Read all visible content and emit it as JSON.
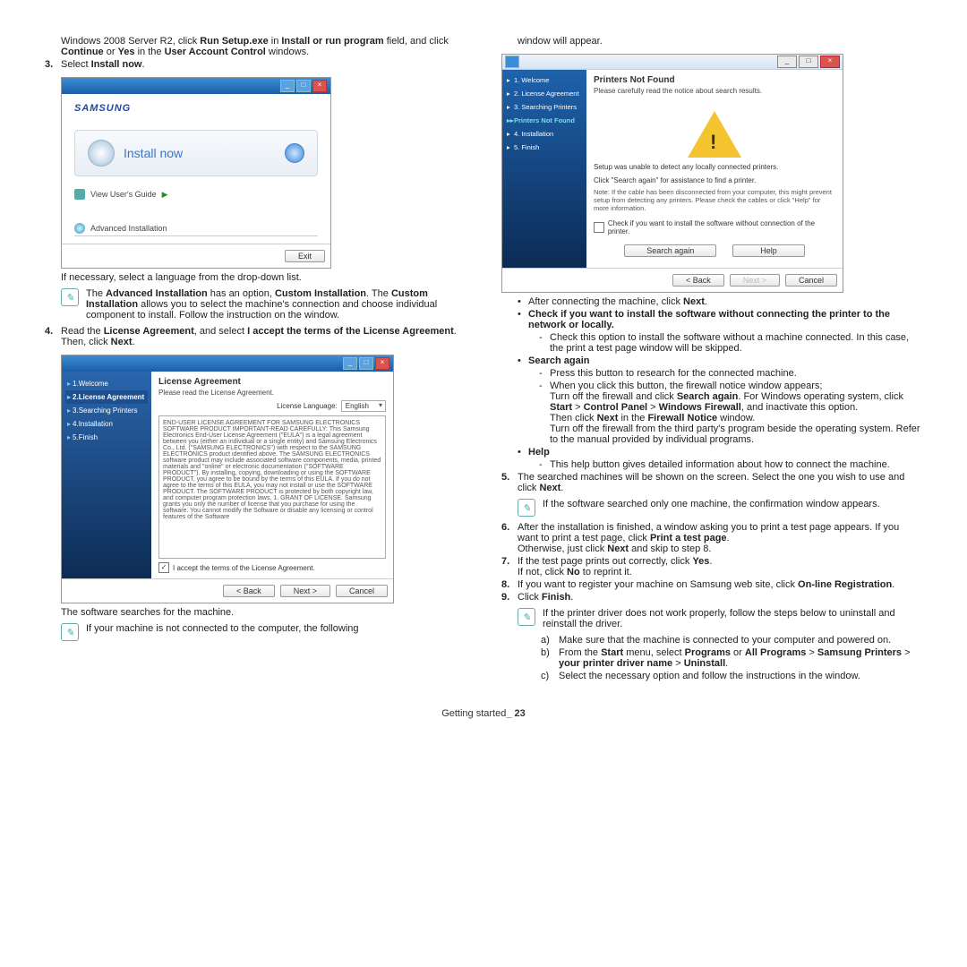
{
  "footer": {
    "text": "Getting started",
    "page": "23"
  },
  "left": {
    "intro_prefix": "Windows 2008 Server R2, click ",
    "intro_b1": "Run Setup.exe",
    "intro_mid1": " in ",
    "intro_b2": "Install or run program",
    "intro_mid2": " field, and click ",
    "intro_b3": "Continue",
    "intro_mid3": " or ",
    "intro_b4": "Yes",
    "intro_mid4": " in the ",
    "intro_b5": "User Account Control",
    "intro_end": " windows.",
    "step3_num": "3.",
    "step3_text_a": "Select ",
    "step3_text_b": "Install now",
    "step3_text_c": ".",
    "shot1": {
      "logo": "SAMSUNG",
      "install_now": "Install now",
      "view_guide": "View User's Guide",
      "advanced": "Advanced Installation",
      "exit": "Exit"
    },
    "after_shot1": "If necessary, select a language from the drop-down list.",
    "note1_a": "The ",
    "note1_b": "Advanced Installation",
    "note1_c": " has an option, ",
    "note1_d": "Custom Installation",
    "note1_e": ". The ",
    "note1_f": "Custom Installation",
    "note1_g": " allows you to select the machine's connection and choose individual component to install. Follow the instruction on the window.",
    "step4_num": "4.",
    "step4_a": "Read the ",
    "step4_b": "License Agreement",
    "step4_c": ", and select ",
    "step4_d": "I accept the terms of the License Agreement",
    "step4_e": ". Then, click ",
    "step4_f": "Next",
    "step4_g": ".",
    "shot2": {
      "sb1": "1.Welcome",
      "sb2": "2.License Agreement",
      "sb3": "3.Searching Printers",
      "sb4": "4.Installation",
      "sb5": "5.Finish",
      "title": "License Agreement",
      "sub": "Please read the License Agreement.",
      "lang_label": "License Language:",
      "lang_value": "English",
      "eula": "END-USER LICENSE AGREEMENT FOR SAMSUNG ELECTRONICS SOFTWARE PRODUCT\n\nIMPORTANT-READ CAREFULLY: This Samsung Electronics End-User License Agreement (\"EULA\") is a legal agreement between you (either an individual or a single entity) and Samsung Electronics Co., Ltd. (\"SAMSUNG ELECTRONICS\") with respect to the SAMSUNG ELECTRONICS product identified above. The SAMSUNG ELECTRONICS software product may include associated software components, media, printed materials and \"online\" or electronic documentation (\"SOFTWARE PRODUCT\"). By installing, copying, downloading or using the SOFTWARE PRODUCT, you agree to be bound by the terms of this EULA. If you do not agree to the terms of this EULA, you may not install or use the SOFTWARE PRODUCT.\nThe SOFTWARE PRODUCT is protected by both copyright law, and computer program protection laws.\n\n1. GRANT OF LICENSE.\nSamsung grants you only the number of license that you purchase for using the software. You cannot modify the Software or disable any licensing or control features of the Software",
      "accept": "I accept the terms of the License Agreement.",
      "back": "< Back",
      "next": "Next >",
      "cancel": "Cancel"
    },
    "after_shot2": "The software searches for the machine.",
    "note2": "If your machine is not connected to the computer, the following"
  },
  "right": {
    "top": "window will appear.",
    "shot3": {
      "sb1": "1. Welcome",
      "sb2": "2. License Agreement",
      "sb3": "3. Searching Printers",
      "sb3a": "Printers Not Found",
      "sb4": "4. Installation",
      "sb5": "5. Finish",
      "title": "Printers Not Found",
      "sub": "Please carefully read the notice about search results.",
      "msg1": "Setup was unable to detect any locally connected printers.",
      "msg2": "Click \"Search again\" for assistance to find a printer.",
      "note": "Note: If the cable has been disconnected from your computer, this might prevent setup from detecting any printers. Please check the cables or click \"Help\" for more information.",
      "check": "Check if you want to install the software without connection of the printer.",
      "search": "Search again",
      "help": "Help",
      "back": "< Back",
      "next": "Next >",
      "cancel": "Cancel"
    },
    "b1_a": "After connecting the machine, click ",
    "b1_b": "Next",
    "b1_c": ".",
    "b2": "Check if you want to install the software without connecting the printer to the network or locally.",
    "b2_d1": "Check this option to install the software without a machine connected. In this case, the print a test page window will be skipped.",
    "b3": "Search again",
    "b3_d1": "Press this button to research for the connected machine.",
    "b3_d2": "When you click this button, the firewall notice window appears;",
    "b3_p1_a": "Turn off the firewall and click ",
    "b3_p1_b": "Search again",
    "b3_p1_c": ". For Windows operating system, click ",
    "b3_p1_d": "Start",
    "b3_p1_e": " > ",
    "b3_p1_f": "Control Panel",
    "b3_p1_g": " > ",
    "b3_p1_h": "Windows Firewall",
    "b3_p1_i": ", and inactivate this option.",
    "b3_p2_a": "Then click ",
    "b3_p2_b": "Next",
    "b3_p2_c": " in the ",
    "b3_p2_d": "Firewall Notice",
    "b3_p2_e": " window.",
    "b3_p3": "Turn off the firewall from the third party's program beside the operating system. Refer to the manual provided by individual programs.",
    "b4": "Help",
    "b4_d1": "This help button gives detailed information about how to connect the machine.",
    "s5_num": "5.",
    "s5_a": "The searched machines will be shown on the screen. Select the one you wish to use and click ",
    "s5_b": "Next",
    "s5_c": ".",
    "note5": "If the software searched only one machine, the confirmation window appears.",
    "s6_num": "6.",
    "s6_a": "After the installation is finished, a window asking you to print a test page appears. If you want to print a test page, click ",
    "s6_b": "Print a test page",
    "s6_c": ".",
    "s6_2a": "Otherwise, just click ",
    "s6_2b": "Next",
    "s6_2c": " and skip to step 8.",
    "s7_num": "7.",
    "s7_a": "If the test page prints out correctly, click ",
    "s7_b": "Yes",
    "s7_c": ".",
    "s7_2a": "If not, click ",
    "s7_2b": "No",
    "s7_2c": " to reprint it.",
    "s8_num": "8.",
    "s8_a": "If you want to register your machine on Samsung web site, click ",
    "s8_b": "On-line Registration",
    "s8_c": ".",
    "s9_num": "9.",
    "s9_a": "Click ",
    "s9_b": "Finish",
    "s9_c": ".",
    "note9": "If the printer driver does not work properly, follow the steps below to uninstall and reinstall the driver.",
    "abc_a_l": "a)",
    "abc_a": "Make sure that the machine is connected to your computer and powered on.",
    "abc_b_l": "b)",
    "abc_b_a": "From the ",
    "abc_b_b": "Start",
    "abc_b_c": " menu, select ",
    "abc_b_d": "Programs",
    "abc_b_e": " or ",
    "abc_b_f": "All Programs",
    "abc_b_g": " > ",
    "abc_b_h": "Samsung Printers",
    "abc_b_i": " > ",
    "abc_b_j": "your printer driver name",
    "abc_b_k": " > ",
    "abc_b_m": "Uninstall",
    "abc_b_n": ".",
    "abc_c_l": "c)",
    "abc_c": "Select the necessary option and follow the instructions in the window."
  }
}
